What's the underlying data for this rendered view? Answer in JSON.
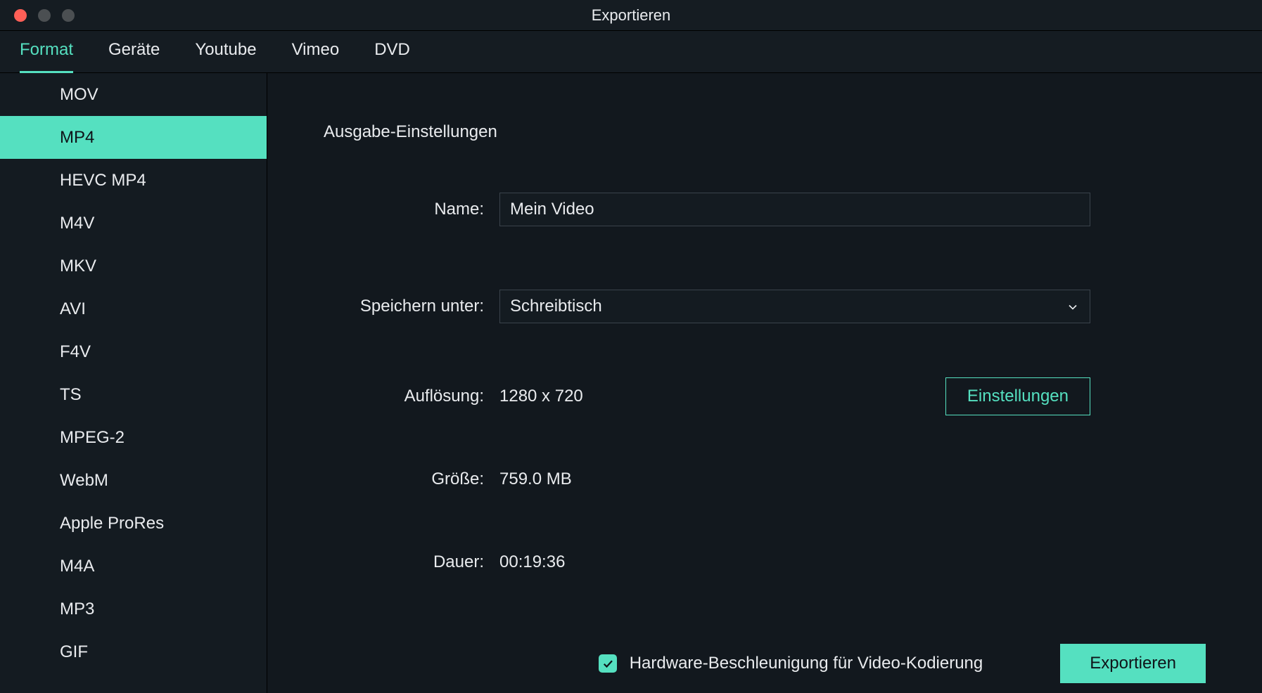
{
  "window": {
    "title": "Exportieren"
  },
  "tabs": {
    "items": [
      {
        "label": "Format",
        "active": true
      },
      {
        "label": "Geräte",
        "active": false
      },
      {
        "label": "Youtube",
        "active": false
      },
      {
        "label": "Vimeo",
        "active": false
      },
      {
        "label": "DVD",
        "active": false
      }
    ]
  },
  "sidebar": {
    "items": [
      {
        "label": "MOV",
        "selected": false
      },
      {
        "label": "MP4",
        "selected": true
      },
      {
        "label": "HEVC MP4",
        "selected": false
      },
      {
        "label": "M4V",
        "selected": false
      },
      {
        "label": "MKV",
        "selected": false
      },
      {
        "label": "AVI",
        "selected": false
      },
      {
        "label": "F4V",
        "selected": false
      },
      {
        "label": "TS",
        "selected": false
      },
      {
        "label": "MPEG-2",
        "selected": false
      },
      {
        "label": "WebM",
        "selected": false
      },
      {
        "label": "Apple ProRes",
        "selected": false
      },
      {
        "label": "M4A",
        "selected": false
      },
      {
        "label": "MP3",
        "selected": false
      },
      {
        "label": "GIF",
        "selected": false
      }
    ]
  },
  "settings": {
    "section_title": "Ausgabe-Einstellungen",
    "name_label": "Name:",
    "name_value": "Mein Video",
    "save_label": "Speichern unter:",
    "save_value": "Schreibtisch",
    "resolution_label": "Auflösung:",
    "resolution_value": "1280 x 720",
    "settings_button": "Einstellungen",
    "size_label": "Größe:",
    "size_value": "759.0 MB",
    "duration_label": "Dauer:",
    "duration_value": "00:19:36",
    "hwaccel_label": "Hardware-Beschleunigung für Video-Kodierung",
    "hwaccel_checked": true,
    "export_button": "Exportieren"
  },
  "colors": {
    "accent": "#55e0c0",
    "bg": "#12181e",
    "panel": "#141b21",
    "border": "#3a434b",
    "text": "#e9ebee"
  }
}
